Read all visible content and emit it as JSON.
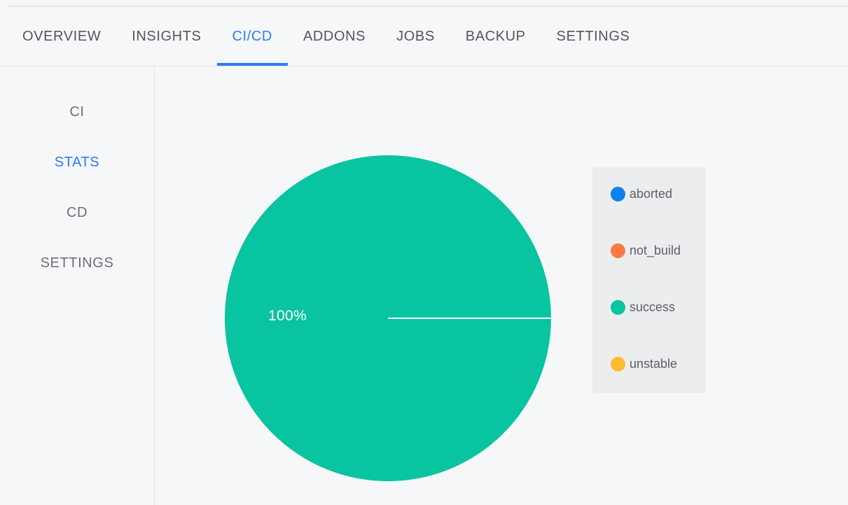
{
  "topbar": {
    "tabs": [
      {
        "label": "OVERVIEW",
        "active": false
      },
      {
        "label": "INSIGHTS",
        "active": false
      },
      {
        "label": "CI/CD",
        "active": true
      },
      {
        "label": "ADDONS",
        "active": false
      },
      {
        "label": "JOBS",
        "active": false
      },
      {
        "label": "BACKUP",
        "active": false
      },
      {
        "label": "SETTINGS",
        "active": false
      }
    ]
  },
  "sidebar": {
    "items": [
      {
        "label": "CI",
        "active": false
      },
      {
        "label": "STATS",
        "active": true
      },
      {
        "label": "CD",
        "active": false
      },
      {
        "label": "SETTINGS",
        "active": false
      }
    ]
  },
  "chart_data": {
    "type": "pie",
    "title": "",
    "categories": [
      "aborted",
      "not_build",
      "success",
      "unstable"
    ],
    "values": [
      0,
      0,
      100,
      0
    ],
    "value_labels": [
      "",
      "",
      "100%",
      ""
    ],
    "colors": [
      "#0c82ed",
      "#f97b44",
      "#08c4a1",
      "#fcbc2e"
    ],
    "legend": {
      "position": "right",
      "entries": [
        {
          "label": "aborted",
          "color": "#0c82ed"
        },
        {
          "label": "not_build",
          "color": "#f97b44"
        },
        {
          "label": "success",
          "color": "#08c4a1"
        },
        {
          "label": "unstable",
          "color": "#fcbc2e"
        }
      ]
    },
    "slice_label": "100%",
    "slice_label_color": "#ffffff",
    "start_angle_deg": 0,
    "grid": false
  },
  "theme": {
    "accent": "#2b7cf6",
    "page_bg": "#f6f7f9",
    "legend_bg": "#ecedef",
    "text_muted": "#6b6f76"
  }
}
